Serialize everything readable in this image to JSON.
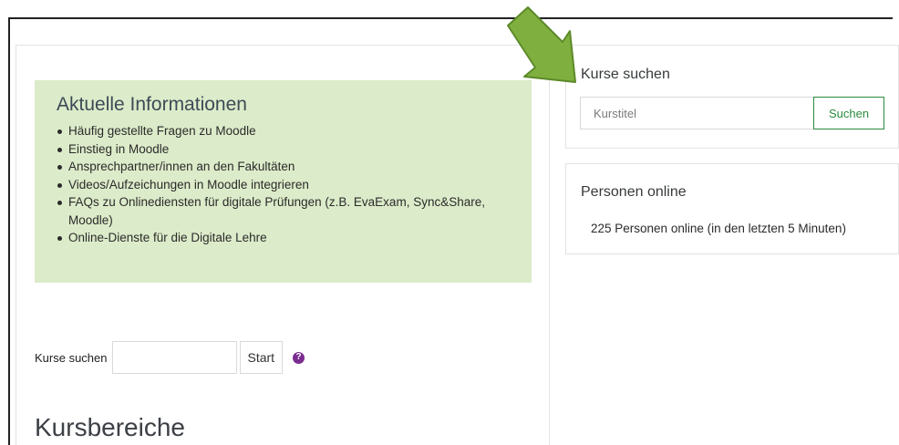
{
  "info": {
    "title": "Aktuelle Informationen",
    "items": [
      "Häufig gestellte Fragen zu Moodle",
      "Einstieg in Moodle",
      "Ansprechpartner/innen an den Fakultäten",
      "Videos/Aufzeichungen in Moodle integrieren",
      "FAQs zu Onlinediensten für digitale Prüfungen (z.B. EvaExam, Sync&Share, Moodle)",
      "Online-Dienste für die Digitale Lehre"
    ],
    "background": "#dcebc9"
  },
  "course_search": {
    "label": "Kurse suchen",
    "button": "Start",
    "help_icon": "question-circle-icon"
  },
  "categories": {
    "title": "Kursbereiche"
  },
  "search_block": {
    "title": "Kurse suchen",
    "placeholder": "Kurstitel",
    "button": "Suchen",
    "accent": "#2b8a3e"
  },
  "online_block": {
    "title": "Personen online",
    "text": "225 Personen online (in den letzten 5 Minuten)"
  },
  "annotation": {
    "icon": "arrow-down-right-icon",
    "color": "#7faf3e"
  }
}
